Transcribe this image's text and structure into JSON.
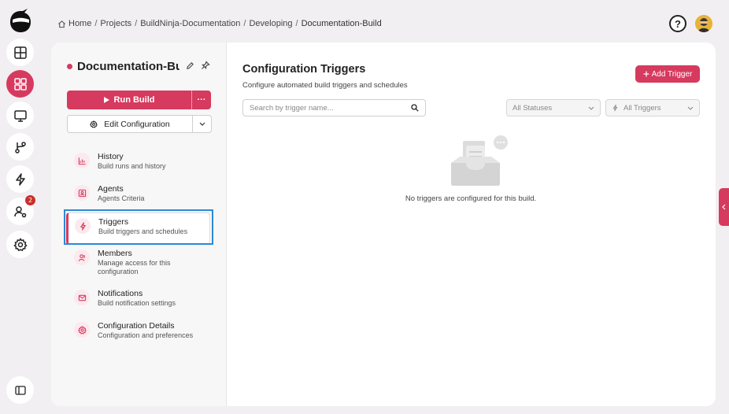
{
  "breadcrumb": {
    "items": [
      "Home",
      "Projects",
      "BuildNinja-Documentation",
      "Developing",
      "Documentation-Build"
    ],
    "separator": "/"
  },
  "header": {
    "help_label": "?"
  },
  "rail": {
    "items": [
      "logo-icon",
      "dashboard-icon",
      "projects-icon",
      "monitor-icon",
      "branch-icon",
      "lightning-icon",
      "users-settings-icon",
      "settings-icon"
    ],
    "active_index": 2,
    "badge_count": "2",
    "bottom_icon": "sidebar-toggle-icon"
  },
  "config": {
    "title": "Documentation-Build",
    "title_display": "Documentation-Bu...",
    "run_label": "Run Build",
    "run_more": "···",
    "edit_label": "Edit Configuration"
  },
  "nav": {
    "active_index": 2,
    "items": [
      {
        "label": "History",
        "sub": "Build runs and history",
        "icon": "chart-icon"
      },
      {
        "label": "Agents",
        "sub": "Agents Criteria",
        "icon": "agent-icon"
      },
      {
        "label": "Triggers",
        "sub": "Build triggers and schedules",
        "icon": "lightning-icon"
      },
      {
        "label": "Members",
        "sub": "Manage access for this configuration",
        "icon": "members-icon"
      },
      {
        "label": "Notifications",
        "sub": "Build notification settings",
        "icon": "mail-icon"
      },
      {
        "label": "Configuration Details",
        "sub": "Configuration and preferences",
        "icon": "gear-icon"
      }
    ]
  },
  "content": {
    "title": "Configuration Triggers",
    "subtitle": "Configure automated build triggers and schedules",
    "add_label": "Add Trigger",
    "search_placeholder": "Search by trigger name...",
    "status_filter": "All Statuses",
    "trigger_filter": "All Triggers",
    "empty_message": "No triggers are configured for this build."
  },
  "colors": {
    "accent": "#d63a5e",
    "highlight": "#2a8ad8"
  }
}
